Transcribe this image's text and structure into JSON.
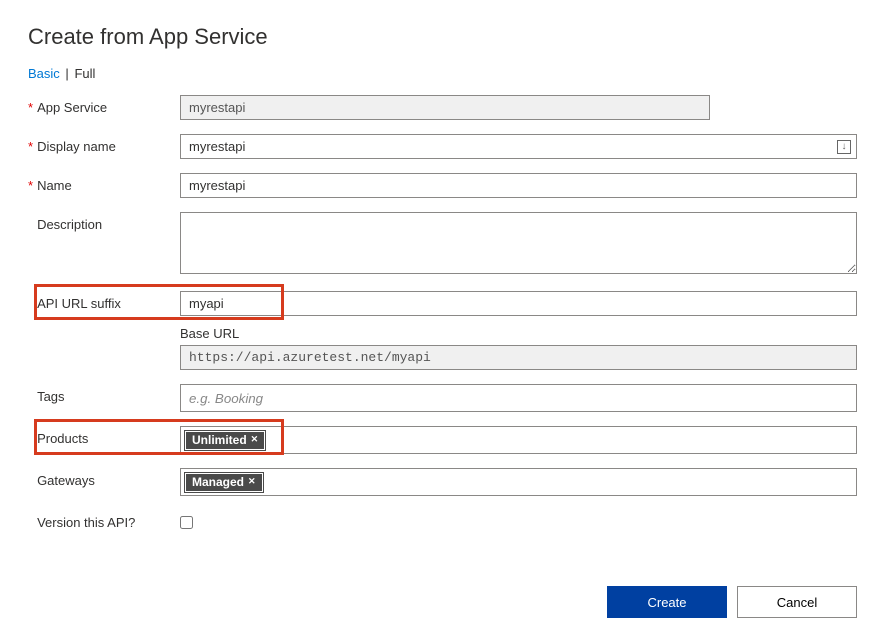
{
  "page": {
    "title": "Create from App Service"
  },
  "tabs": {
    "basic": "Basic",
    "separator": "|",
    "full": "Full"
  },
  "labels": {
    "app_service": "App Service",
    "display_name": "Display name",
    "name": "Name",
    "description": "Description",
    "api_url_suffix": "API URL suffix",
    "base_url": "Base URL",
    "tags": "Tags",
    "products": "Products",
    "gateways": "Gateways",
    "version": "Version this API?"
  },
  "values": {
    "app_service": "myrestapi",
    "display_name": "myrestapi",
    "name": "myrestapi",
    "description": "",
    "api_url_suffix": "myapi",
    "base_url": "https://api.azuretest.net/myapi",
    "tags_placeholder": "e.g. Booking",
    "products_pill": "Unlimited",
    "gateways_pill": "Managed",
    "version_checked": false
  },
  "actions": {
    "create": "Create",
    "cancel": "Cancel"
  },
  "icons": {
    "save_glyph": "↓"
  }
}
